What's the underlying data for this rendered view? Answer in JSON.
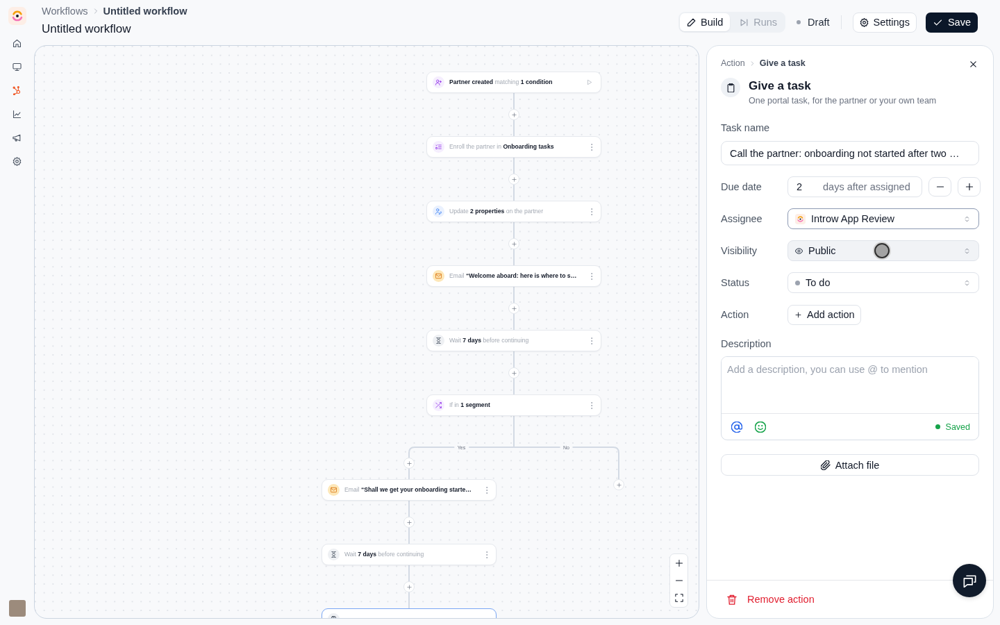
{
  "header": {
    "breadcrumb": [
      "Workflows",
      "Untitled workflow"
    ],
    "title": "Untitled workflow",
    "tabs": [
      {
        "kind": "build",
        "label": "Build",
        "selected": true
      },
      {
        "kind": "runs",
        "label": "Runs",
        "selected": false
      }
    ],
    "status": "Draft",
    "settings_button": "Settings",
    "save_button": "Save"
  },
  "canvas": {
    "steps": [
      {
        "kind": "trigger",
        "text": "**Partner created** matching **1 condition**",
        "selected": false
      },
      {
        "kind": "enroll",
        "text": "Enroll the partner in **Onboarding tasks**",
        "selected": false
      },
      {
        "kind": "update",
        "text": "Update **2 properties** on the partner",
        "selected": false
      },
      {
        "kind": "email",
        "text": "Email **“Welcome aboard: here is where to s…**",
        "selected": false
      },
      {
        "kind": "wait",
        "text": "Wait **7 days** before continuing",
        "selected": false
      },
      {
        "kind": "branch",
        "text": "If in **1 segment**",
        "selected": false
      }
    ],
    "branches": [
      {
        "label": "Yes",
        "steps": [
          {
            "kind": "email",
            "text": "Email **“Shall we get your onboarding starte…**",
            "selected": false
          },
          {
            "kind": "wait",
            "text": "Wait **7 days** before continuing",
            "selected": false
          },
          {
            "kind": "task",
            "selected": true
          }
        ]
      },
      {
        "label": "No"
      }
    ]
  },
  "panel": {
    "breadcrumb": [
      "Action",
      "Give a task"
    ],
    "title": "Give a task",
    "subtitle": "One portal task, for the partner or your own team",
    "task_name": {
      "label": "Task name",
      "value": "Call the partner: onboarding not started after two …"
    },
    "fields": [
      {
        "kind": "stepper",
        "label": "Due date",
        "value": "2",
        "suffix": "days after assigned",
        "focused": false,
        "hovered": false
      },
      {
        "kind": "assignee",
        "label": "Assignee",
        "value": "Introw App Review",
        "focused": true,
        "hovered": false
      },
      {
        "kind": "visibility",
        "label": "Visibility",
        "value": "Public",
        "focused": false,
        "hovered": true
      },
      {
        "kind": "status",
        "label": "Status",
        "value": "To do",
        "color": "#9ca3af",
        "focused": false,
        "hovered": false
      },
      {
        "kind": "action",
        "label": "Action",
        "button": "Add action",
        "focused": false,
        "hovered": false
      }
    ],
    "description": {
      "label": "Description",
      "placeholder": "Add a description, you can use @ to mention",
      "save_status": "Saved"
    },
    "attach_button": "Attach file",
    "remove_button": "Remove action"
  }
}
